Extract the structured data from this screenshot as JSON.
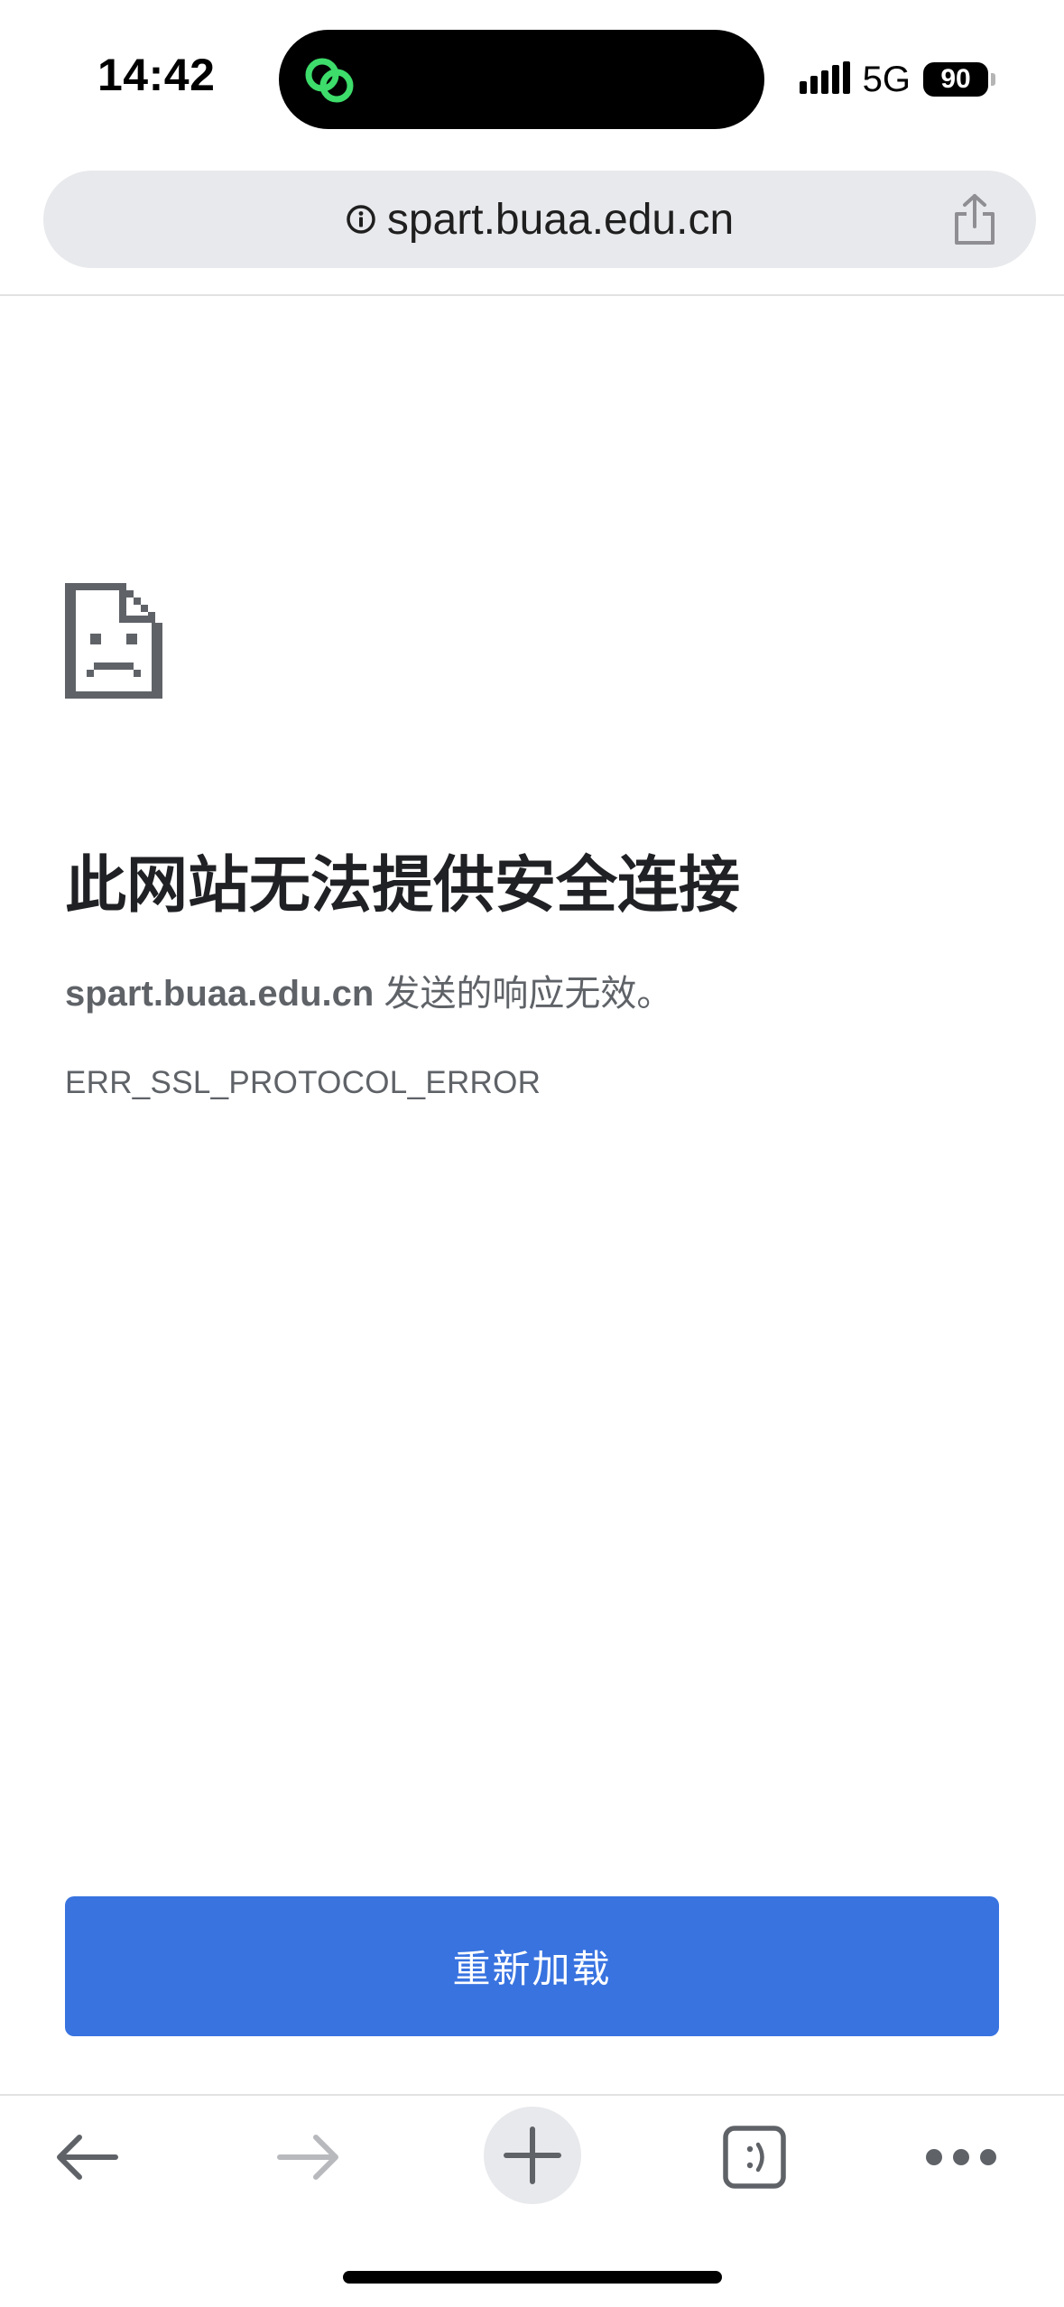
{
  "status_bar": {
    "time": "14:42",
    "network": "5G",
    "battery_level": "90"
  },
  "address_bar": {
    "url": "spart.buaa.edu.cn"
  },
  "error_page": {
    "title": "此网站无法提供安全连接",
    "host": "spart.buaa.edu.cn",
    "message": " 发送的响应无效。",
    "error_code": "ERR_SSL_PROTOCOL_ERROR",
    "reload_label": "重新加载"
  },
  "toolbar": {
    "items": [
      "back-arrow-icon",
      "forward-arrow-icon",
      "plus-icon",
      "tab-switcher-icon",
      "more-dots-icon"
    ]
  },
  "colors": {
    "accent": "#3873e0",
    "address_bg": "#e8e9ec",
    "island_icon": "#3ddc6b"
  }
}
